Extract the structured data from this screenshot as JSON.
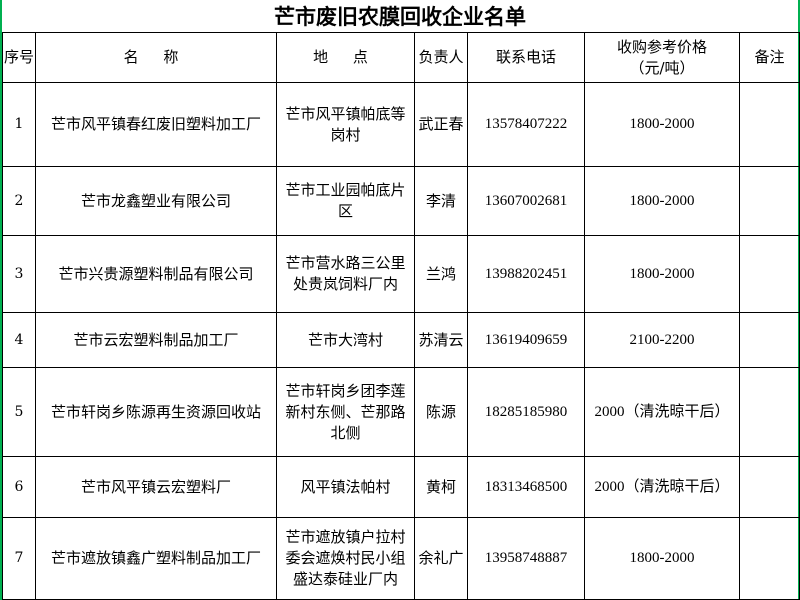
{
  "title": "芒市废旧农膜回收企业名单",
  "columns": {
    "index": "序号",
    "name": "名 称",
    "location": "地 点",
    "contact": "负责人",
    "phone": "联系电话",
    "price_line1": "收购参考价格",
    "price_line2": "（元/吨）",
    "remarks": "备注"
  },
  "rows": [
    {
      "index": "1",
      "name": "芒市风平镇春红废旧塑料加工厂",
      "location": [
        "芒市风平镇帕底等",
        "岗村"
      ],
      "contact": "武正春",
      "phone": "13578407222",
      "price": "1800-2000",
      "remarks": ""
    },
    {
      "index": "2",
      "name": "芒市龙鑫塑业有限公司",
      "location": [
        "芒市工业园帕底片",
        "区"
      ],
      "contact": "李清",
      "phone": "13607002681",
      "price": "1800-2000",
      "remarks": ""
    },
    {
      "index": "3",
      "name": "芒市兴贵源塑料制品有限公司",
      "location": [
        "芒市营水路三公里",
        "处贵岚饲料厂内"
      ],
      "contact": "兰鸿",
      "phone": "13988202451",
      "price": "1800-2000",
      "remarks": ""
    },
    {
      "index": "4",
      "name": "芒市云宏塑料制品加工厂",
      "location": [
        "芒市大湾村"
      ],
      "contact": "苏清云",
      "phone": "13619409659",
      "price": "2100-2200",
      "remarks": ""
    },
    {
      "index": "5",
      "name": "芒市轩岗乡陈源再生资源回收站",
      "location": [
        "芒市轩岗乡团李莲",
        "新村东侧、芒那路",
        "北侧"
      ],
      "contact": "陈源",
      "phone": "18285185980",
      "price": "2000（清洗晾干后）",
      "remarks": ""
    },
    {
      "index": "6",
      "name": "芒市风平镇云宏塑料厂",
      "location": [
        "风平镇法帕村"
      ],
      "contact": "黄柯",
      "phone": "18313468500",
      "price": "2000（清洗晾干后）",
      "remarks": ""
    },
    {
      "index": "7",
      "name": "芒市遮放镇鑫广塑料制品加工厂",
      "location": [
        "芒市遮放镇户拉村",
        "委会遮焕村民小组",
        "盛达泰硅业厂内"
      ],
      "contact": "余礼广",
      "phone": "13958748887",
      "price": "1800-2000",
      "remarks": ""
    }
  ]
}
